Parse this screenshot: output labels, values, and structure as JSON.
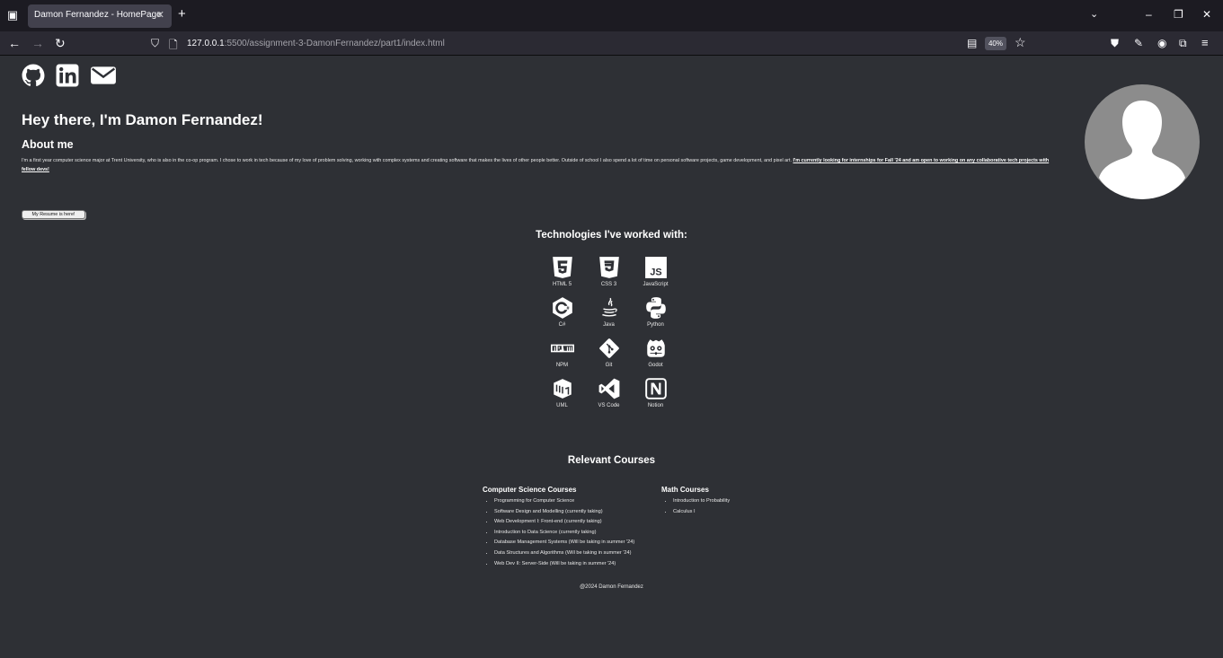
{
  "browser": {
    "tab_title": "Damon Fernandez - HomePage",
    "tab_close": "✕",
    "new_tab": "+",
    "url_host": "127.0.0.1",
    "url_rest": ":5500/assignment-3-DamonFernandez/part1/index.html",
    "zoom": "40%"
  },
  "page": {
    "social": [
      "github-icon",
      "linkedin-icon",
      "envelope-icon"
    ],
    "hero_title": "Hey there, I'm Damon Fernandez!",
    "about_title": "About me",
    "about_text": "I'm a first year computer science major at Trent University, who is also in the co-op program. I chose to work in tech because of my love of problem solving, working with complex systems and creating software that makes the lives of other people better. Outside of school I also spend a lot of time on personal software projects, game development, and pixel art. ",
    "about_link": "I'm currently looking for internships for Fall '24 and am open to working on any collaborative tech projects with fellow devs!",
    "resume_button": "My Resume is here!",
    "tech_title": "Technologies I've worked with:",
    "tech": [
      {
        "label": "HTML 5",
        "icon": "html5-icon"
      },
      {
        "label": "CSS 3",
        "icon": "css3-icon"
      },
      {
        "label": "JavaScript",
        "icon": "javascript-icon"
      },
      {
        "label": "C#",
        "icon": "csharp-icon"
      },
      {
        "label": "Java",
        "icon": "java-icon"
      },
      {
        "label": "Python",
        "icon": "python-icon"
      },
      {
        "label": "NPM",
        "icon": "npm-icon"
      },
      {
        "label": "Git",
        "icon": "git-icon"
      },
      {
        "label": "Godot",
        "icon": "godot-icon"
      },
      {
        "label": "UML",
        "icon": "uml-icon"
      },
      {
        "label": "VS Code",
        "icon": "vscode-icon"
      },
      {
        "label": "Notion",
        "icon": "notion-icon"
      }
    ],
    "courses_title": "Relevant Courses",
    "cs_title": "Computer Science Courses",
    "cs_courses": [
      "Programming for Computer Science",
      "Software Design and Modelling (currently taking)",
      "Web Development I: Front-end (currently taking)",
      "Introduction to Data Science (currently taking)",
      "Database Management Systems (Will be taking in summer '24)",
      "Data Structures and Algorithms (Will be taking in summer '24)",
      "Web Dev II: Server-Side (Will be taking in summer '24)"
    ],
    "math_title": "Math Courses",
    "math_courses": [
      "Introduction to Probability",
      "Calculus I"
    ],
    "footer": "@2024 Damon Fernandez"
  },
  "colors": {
    "background": "#2e3035",
    "chrome_dark": "#1c1b22",
    "avatar": "#8c8c8c"
  }
}
